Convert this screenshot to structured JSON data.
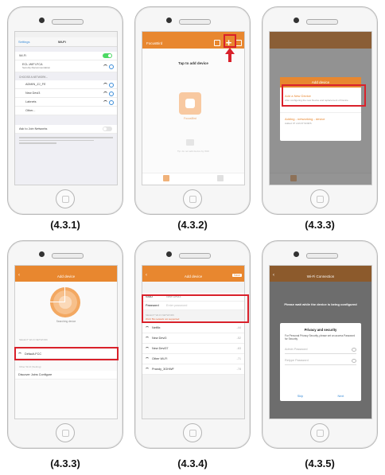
{
  "captions": [
    "(4.3.1)",
    "(4.3.2)",
    "(4.3.3)",
    "(4.3.3)",
    "(4.3.4)",
    "(4.3.5)"
  ],
  "colors": {
    "accent": "#e8872f",
    "highlight": "#d9212b",
    "toggle_on": "#4cd964"
  },
  "screen1": {
    "back": "Settings",
    "title": "Wi-Fi",
    "wifi_label": "Wi-Fi",
    "connected_network": "ECL-WIFI-FCA",
    "connected_sub": "Security Recommendation",
    "section": "CHOOSE A NETWORK...",
    "networks": [
      "ADMIN_ZJ_FE",
      "New Devi3",
      "Labnets",
      "Other..."
    ],
    "ask_label": "Ask to Join Networks"
  },
  "screen2": {
    "app_title": "FocusBird",
    "tap_text": "Tap to add device",
    "device_name": "FocusBird",
    "hint": "Tip: do not add device by WiFi"
  },
  "screen3": {
    "dialog_title": "Add device",
    "option1_title": "Add a New Device",
    "option1_sub": "After configuring the new Device and replacement of Device",
    "option2_title": "Adding - networking - device",
    "option2_sub": "Added: IP LAN IP SOIRS"
  },
  "screen4": {
    "title": "Add device",
    "scan_label": "Searching device",
    "section1": "SELECT WI-FI NETWORK",
    "selected_network": "Default-FCC",
    "section2": "Other Wi-Fi (Setting)",
    "other_network": "Discover Joins Configure"
  },
  "screen5": {
    "title": "Add device",
    "save": "Save",
    "ssid_label": "SSID",
    "ssid_value": "New Devi3",
    "password_label": "Password",
    "password_value": "Enter password",
    "section": "SELECT WI-FI NETWORK",
    "warning": "Wi-Fi 5G network not supported",
    "networks": [
      "Netflix",
      "New Devi3",
      "New Devi37",
      "Other Wi-Fi",
      "Prandy_3GHWF"
    ],
    "signals": [
      "-44",
      "-52",
      "-63",
      "-71",
      "-78"
    ]
  },
  "screen6": {
    "title": "Wi-Fi Connection",
    "notice": "Please wait while the device is being configured",
    "dialog_title": "Privacy and security",
    "dialog_body": "For Personal Privacy Security, please set an access Password for Security",
    "field1": "Admin Password",
    "field2": "Retype Password",
    "cancel": "Skip",
    "confirm": "Next"
  }
}
